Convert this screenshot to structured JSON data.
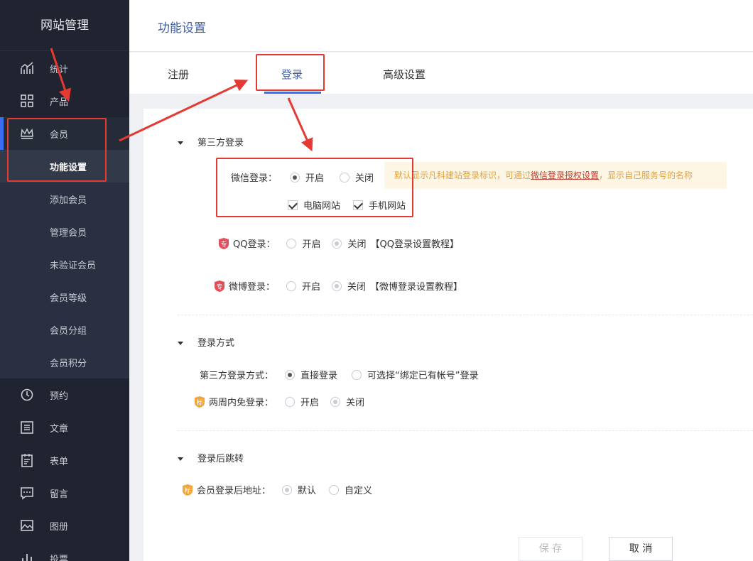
{
  "sidebar": {
    "brand": "网站管理",
    "items": [
      {
        "label": "统计",
        "icon": "chart-line-icon"
      },
      {
        "label": "产品",
        "icon": "grid-icon"
      },
      {
        "label": "会员",
        "icon": "crown-icon"
      },
      {
        "label": "预约",
        "icon": "clock-icon"
      },
      {
        "label": "文章",
        "icon": "list-icon"
      },
      {
        "label": "表单",
        "icon": "clipboard-icon"
      },
      {
        "label": "留言",
        "icon": "message-icon"
      },
      {
        "label": "图册",
        "icon": "image-icon"
      },
      {
        "label": "投票",
        "icon": "bar-chart-icon"
      }
    ],
    "member_sub": [
      "功能设置",
      "添加会员",
      "管理会员",
      "未验证会员",
      "会员等级",
      "会员分组",
      "会员积分"
    ]
  },
  "header": {
    "title": "功能设置"
  },
  "tabs": [
    {
      "label": "注册"
    },
    {
      "label": "登录"
    },
    {
      "label": "高级设置"
    }
  ],
  "third_party": {
    "heading": "第三方登录",
    "wechat": {
      "label": "微信登录：",
      "on": "开启",
      "off": "关闭",
      "selected": "on",
      "pc": "电脑网站",
      "mobile": "手机网站"
    },
    "notice": {
      "before": "默认显示凡科建站登录标识，可通过",
      "link": "微信登录授权设置",
      "after": "，显示自己服务号的名称"
    },
    "qq": {
      "label": "QQ登录：",
      "on": "开启",
      "off": "关闭",
      "selected": "off",
      "tutorial": "【QQ登录设置教程】"
    },
    "weibo": {
      "label": "微博登录：",
      "on": "开启",
      "off": "关闭",
      "selected": "off",
      "tutorial": "【微博登录设置教程】"
    }
  },
  "login_method": {
    "heading": "登录方式",
    "method_label": "第三方登录方式：",
    "direct": "直接登录",
    "bind": "可选择“绑定已有帐号”登录",
    "remember_label": "两周内免登录：",
    "on": "开启",
    "off": "关闭",
    "remember_selected": "off"
  },
  "redirect": {
    "heading": "登录后跳转",
    "label": "会员登录后地址：",
    "default": "默认",
    "custom": "自定义",
    "selected": "default"
  },
  "buttons": {
    "save": "保 存",
    "cancel": "取 消"
  },
  "badges": {
    "pro": "专",
    "std": "标"
  },
  "colors": {
    "accent": "#3b6ef5",
    "annotation": "#e53a33",
    "sidebar_bg": "#1f2430"
  }
}
